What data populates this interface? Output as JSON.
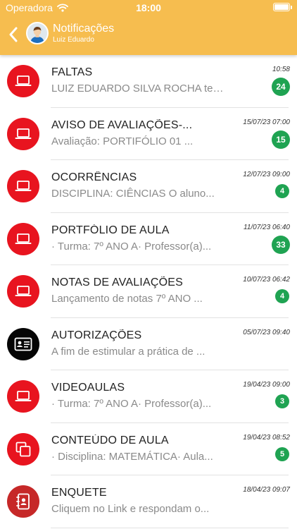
{
  "status_bar": {
    "carrier": "Operadora",
    "time": "18:00"
  },
  "nav": {
    "title": "Notificações",
    "subtitle": "Luiz Eduardo"
  },
  "colors": {
    "header": "#f6bd4f",
    "icon_red": "#e8141f",
    "icon_black": "#050505",
    "icon_dark_red": "#c62828",
    "badge_green": "#1fa352"
  },
  "notifications": [
    {
      "title": "FALTAS",
      "preview": "LUIZ EDUARDO SILVA ROCHA teve ...",
      "time": "10:58",
      "badge": "24",
      "icon": "laptop-icon",
      "icon_color": "red"
    },
    {
      "title": "AVISO DE AVALIAÇÕES-...",
      "preview": "Avaliação: PORTIFÓLIO 01 ...",
      "time": "15/07/23 07:00",
      "badge": "15",
      "icon": "laptop-icon",
      "icon_color": "red"
    },
    {
      "title": "OCORRÊNCIAS",
      "preview": "DISCIPLINA: CIÊNCIAS O aluno...",
      "time": "12/07/23 09:00",
      "badge": "4",
      "icon": "laptop-icon",
      "icon_color": "red"
    },
    {
      "title": "PORTFÓLIO DE AULA",
      "preview": "· Turma: 7º ANO A· Professor(a)...",
      "time": "11/07/23 06:40",
      "badge": "33",
      "icon": "laptop-icon",
      "icon_color": "red"
    },
    {
      "title": "NOTAS DE AVALIAÇÕES",
      "preview": "Lançamento de notas 7º ANO ...",
      "time": "10/07/23 06:42",
      "badge": "4",
      "icon": "laptop-icon",
      "icon_color": "red"
    },
    {
      "title": "AUTORIZAÇÕES",
      "preview": "A fim de estimular a prática de ...",
      "time": "05/07/23 09:40",
      "badge": "",
      "icon": "id-card-icon",
      "icon_color": "black"
    },
    {
      "title": "VIDEOAULAS",
      "preview": "· Turma: 7º ANO A· Professor(a)...",
      "time": "19/04/23 09:00",
      "badge": "3",
      "icon": "laptop-icon",
      "icon_color": "red"
    },
    {
      "title": "CONTEÚDO DE AULA",
      "preview": "· Disciplina: MATEMÁTICA· Aula...",
      "time": "19/04/23 08:52",
      "badge": "5",
      "icon": "copy-icon",
      "icon_color": "red"
    },
    {
      "title": "ENQUETE",
      "preview": "Cliquem no Link e respondam o...",
      "time": "18/04/23 09:07",
      "badge": "",
      "icon": "contacts-book-icon",
      "icon_color": "dark-red"
    }
  ]
}
